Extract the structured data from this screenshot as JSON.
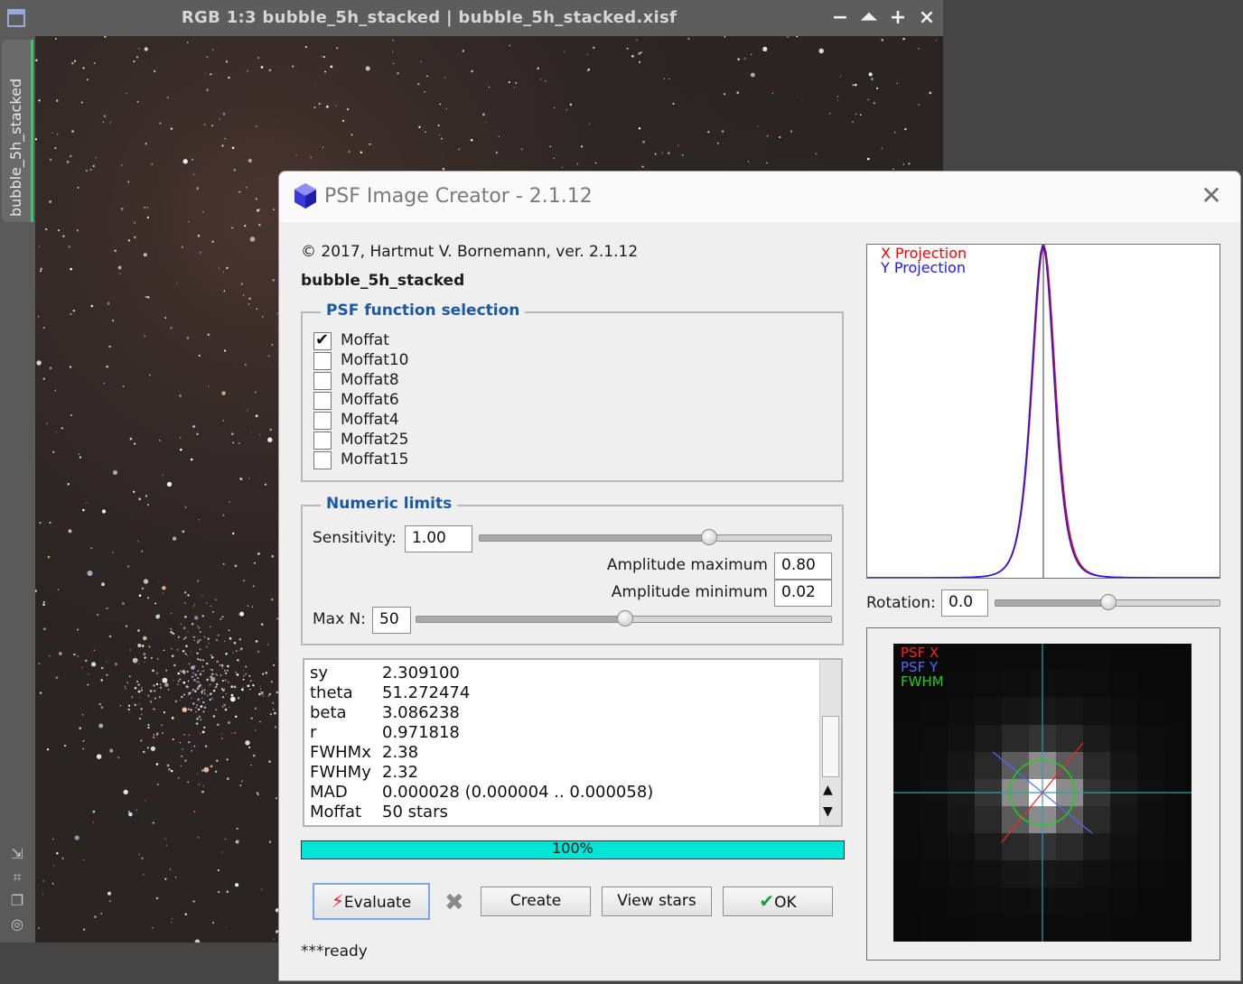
{
  "image_window": {
    "title": "RGB 1:3 bubble_5h_stacked | bubble_5h_stacked.xisf",
    "side_tab": "bubble_5h_stacked",
    "buttons": {
      "minimize": "−",
      "shade": "⏶",
      "maximize": "+",
      "close": "×"
    }
  },
  "dialog": {
    "title": "PSF Image Creator - 2.1.12",
    "copyright": "© 2017, Hartmut V. Bornemann, ver. 2.1.12",
    "image_name": "bubble_5h_stacked",
    "psf_group": {
      "title": "PSF function selection",
      "options": [
        {
          "label": "Moffat",
          "checked": true
        },
        {
          "label": "Moffat10",
          "checked": false
        },
        {
          "label": "Moffat8",
          "checked": false
        },
        {
          "label": "Moffat6",
          "checked": false
        },
        {
          "label": "Moffat4",
          "checked": false
        },
        {
          "label": "Moffat25",
          "checked": false
        },
        {
          "label": "Moffat15",
          "checked": false
        }
      ]
    },
    "numeric_group": {
      "title": "Numeric limits",
      "sensitivity_label": "Sensitivity:",
      "sensitivity_value": "1.00",
      "sensitivity_slider_fraction": 0.65,
      "amp_max_label": "Amplitude maximum",
      "amp_max_value": "0.80",
      "amp_min_label": "Amplitude minimum",
      "amp_min_value": "0.02",
      "maxn_label": "Max N:",
      "maxn_value": "50",
      "maxn_slider_fraction": 0.5
    },
    "results": [
      {
        "key": "sy",
        "value": "2.309100"
      },
      {
        "key": "theta",
        "value": "51.272474"
      },
      {
        "key": "beta",
        "value": "3.086238"
      },
      {
        "key": "r",
        "value": "0.971818"
      },
      {
        "key": "FWHMx",
        "value": "2.38"
      },
      {
        "key": "FWHMy",
        "value": "2.32"
      },
      {
        "key": "MAD",
        "value": "0.000028 (0.000004 .. 0.000058)"
      },
      {
        "key": "Moffat",
        "value": "50 stars"
      }
    ],
    "progress_text": "100%",
    "progress_fraction": 1.0,
    "buttons": {
      "evaluate": "Evaluate",
      "create": "Create",
      "view_stars": "View stars",
      "ok": "OK"
    },
    "status": "***ready",
    "projection": {
      "x_label": "X Projection",
      "y_label": "Y Projection",
      "x_color": "#ff0000",
      "y_color": "#1a1aff"
    },
    "rotation_label": "Rotation:",
    "rotation_value": "0.0",
    "rotation_slider_fraction": 0.5,
    "psf_view": {
      "legend_x": "PSF X",
      "legend_y": "PSF Y",
      "legend_fwhm": "FWHM",
      "x_color": "#ff2020",
      "y_color": "#4a6cff",
      "fwhm_color": "#22cc22"
    },
    "icons": {
      "app": "cube-icon",
      "close": "close-icon",
      "evaluate": "lightning-icon",
      "ok": "check-icon",
      "abort": "cross-icon"
    }
  }
}
